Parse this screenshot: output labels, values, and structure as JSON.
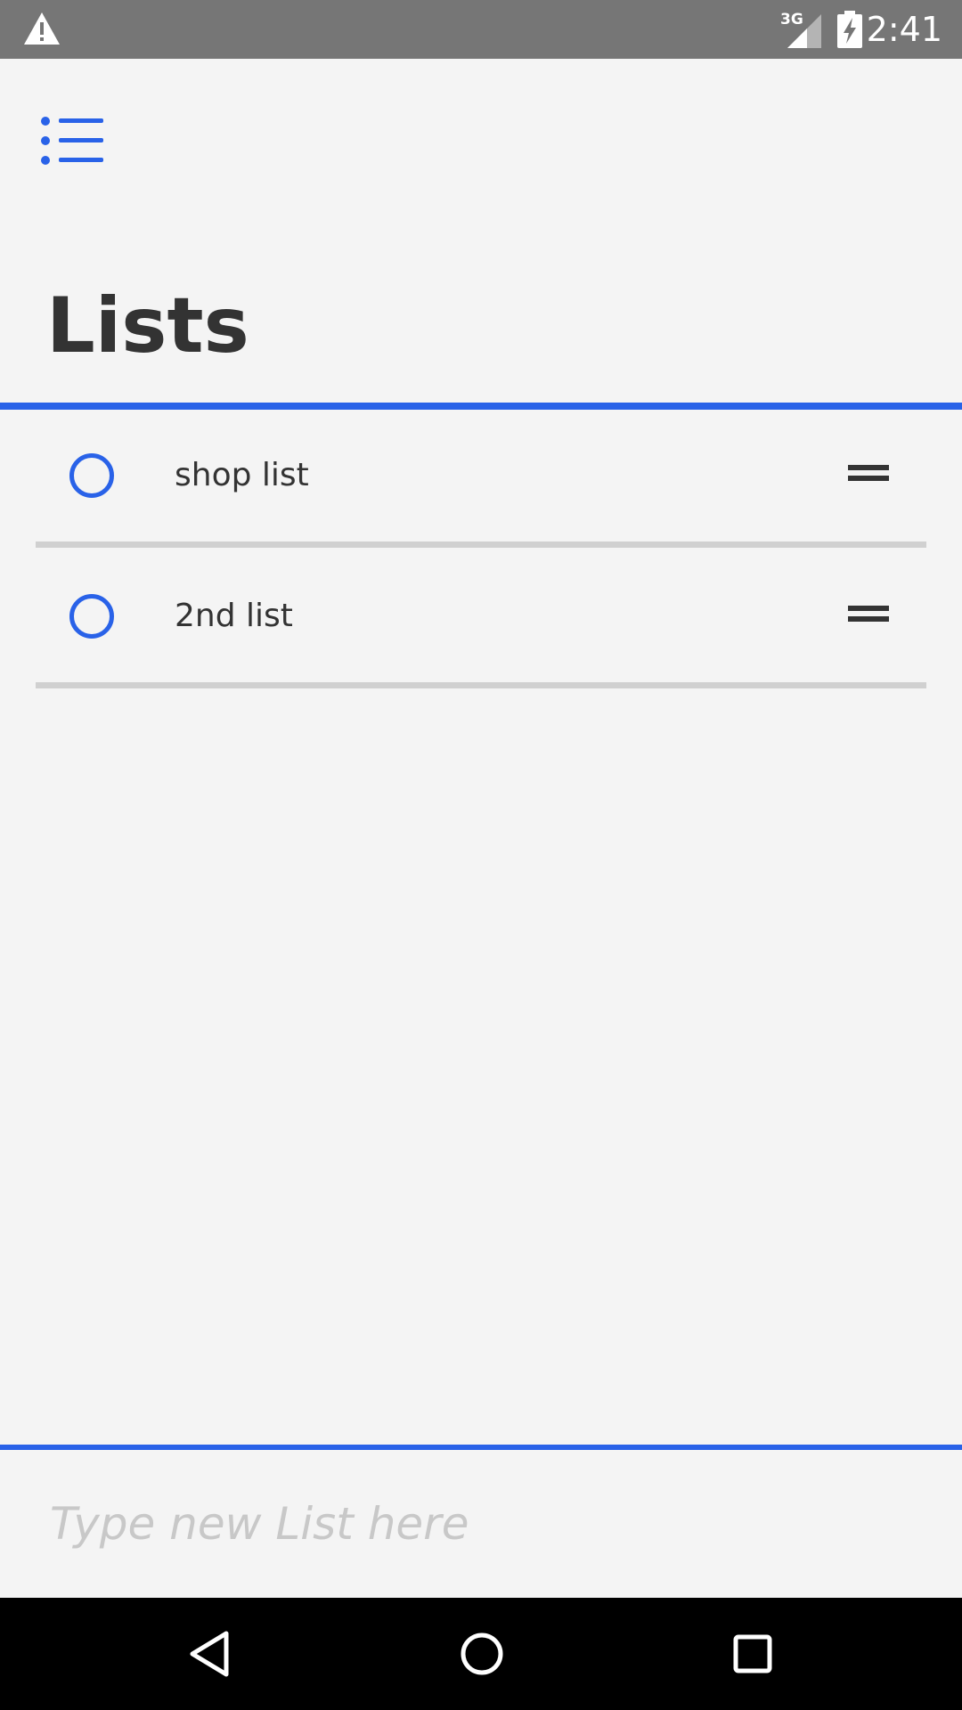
{
  "status_bar": {
    "warning_icon": "warning-icon",
    "network_type": "3G",
    "battery_icon": "battery-charging-icon",
    "time": "2:41"
  },
  "header": {
    "menu_icon": "list-menu-icon",
    "title": "Lists"
  },
  "lists": [
    {
      "label": "shop list",
      "checked": false,
      "handle_icon": "drag-handle-icon"
    },
    {
      "label": "2nd list",
      "checked": false,
      "handle_icon": "drag-handle-icon"
    }
  ],
  "new_list": {
    "placeholder": "Type new List here",
    "value": ""
  },
  "navigation": {
    "back_icon": "back-icon",
    "home_icon": "home-icon",
    "recents_icon": "recents-icon"
  },
  "colors": {
    "accent": "#2962e8",
    "background": "#f4f4f4",
    "text": "#333333",
    "status_bar": "#767676",
    "divider": "#d0d0d0",
    "nav_bar": "#000000"
  }
}
